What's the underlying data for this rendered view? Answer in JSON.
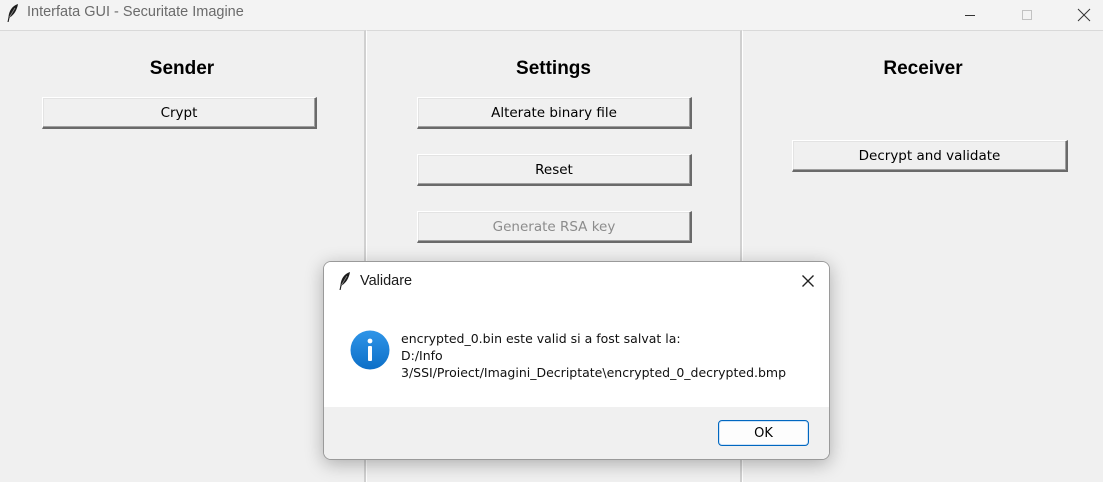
{
  "window": {
    "title": "Interfata GUI - Securitate Imagine",
    "controls": [
      "minimize-icon",
      "maximize-icon",
      "close-icon"
    ]
  },
  "sender": {
    "heading": "Sender",
    "crypt_label": "Crypt"
  },
  "settings": {
    "heading": "Settings",
    "alterate_label": "Alterate binary file",
    "reset_label": "Reset",
    "generate_label": "Generate RSA key",
    "generate_disabled": true
  },
  "receiver": {
    "heading": "Receiver",
    "decrypt_label": "Decrypt and validate"
  },
  "dialog": {
    "title": "Validare",
    "icon": "info-icon",
    "message_lines": [
      "encrypted_0.bin este valid si a fost salvat la:",
      "D:/Info",
      "3/SSI/Proiect/Imagini_Decriptate\\encrypted_0_decrypted.bmp"
    ],
    "ok_label": "OK"
  },
  "colors": {
    "window_bg": "#f0f0f0",
    "info_blue": "#1e7fd6",
    "ok_border": "#0067c0"
  }
}
